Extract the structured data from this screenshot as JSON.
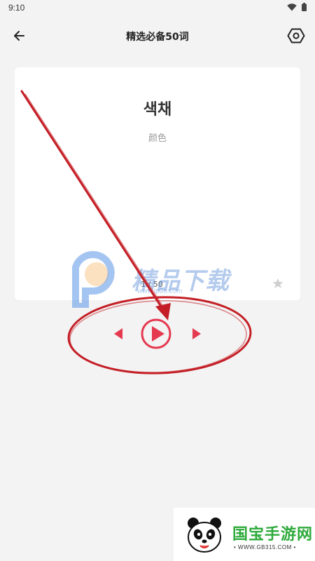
{
  "status_bar": {
    "time": "9:10"
  },
  "header": {
    "title": "精选必备50词"
  },
  "card": {
    "korean_word": "색채",
    "meaning": "颜色",
    "progress": "1 / 50"
  },
  "watermark": {
    "brand": "精品下载",
    "url": "www.jp9o.com"
  },
  "corner_badge": {
    "brand": "国宝手游网",
    "url": "• WWW.GB315.COM •"
  },
  "colors": {
    "accent": "#e53950",
    "annotation": "#d0262c",
    "background": "#f3f3f3",
    "card": "#ffffff"
  },
  "icons": [
    "back-arrow-icon",
    "settings-hexagon-icon",
    "star-icon",
    "prev-triangle-icon",
    "play-circle-icon",
    "next-triangle-icon"
  ]
}
